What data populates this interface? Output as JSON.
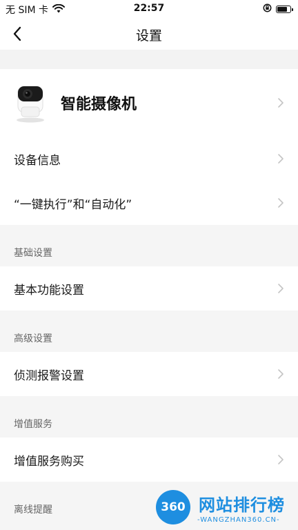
{
  "status_bar": {
    "carrier": "无 SIM 卡",
    "time": "22:57"
  },
  "nav": {
    "title": "设置"
  },
  "device": {
    "name": "智能摄像机"
  },
  "top_group": {
    "items": [
      {
        "label": "设备信息"
      },
      {
        "label": "“一键执行”和“自动化”"
      }
    ]
  },
  "sections": [
    {
      "header": "基础设置",
      "items": [
        {
          "label": "基本功能设置"
        }
      ]
    },
    {
      "header": "高级设置",
      "items": [
        {
          "label": "侦测报警设置"
        }
      ]
    },
    {
      "header": "增值服务",
      "items": [
        {
          "label": "增值服务购买"
        }
      ]
    },
    {
      "header": "离线提醒",
      "items": []
    }
  ],
  "watermark": {
    "badge": "360",
    "title": "网站排行榜",
    "subtitle": "-WANGZHAN360.CN-"
  },
  "colors": {
    "accent": "#1e8ee0",
    "background": "#f5f5f5"
  }
}
